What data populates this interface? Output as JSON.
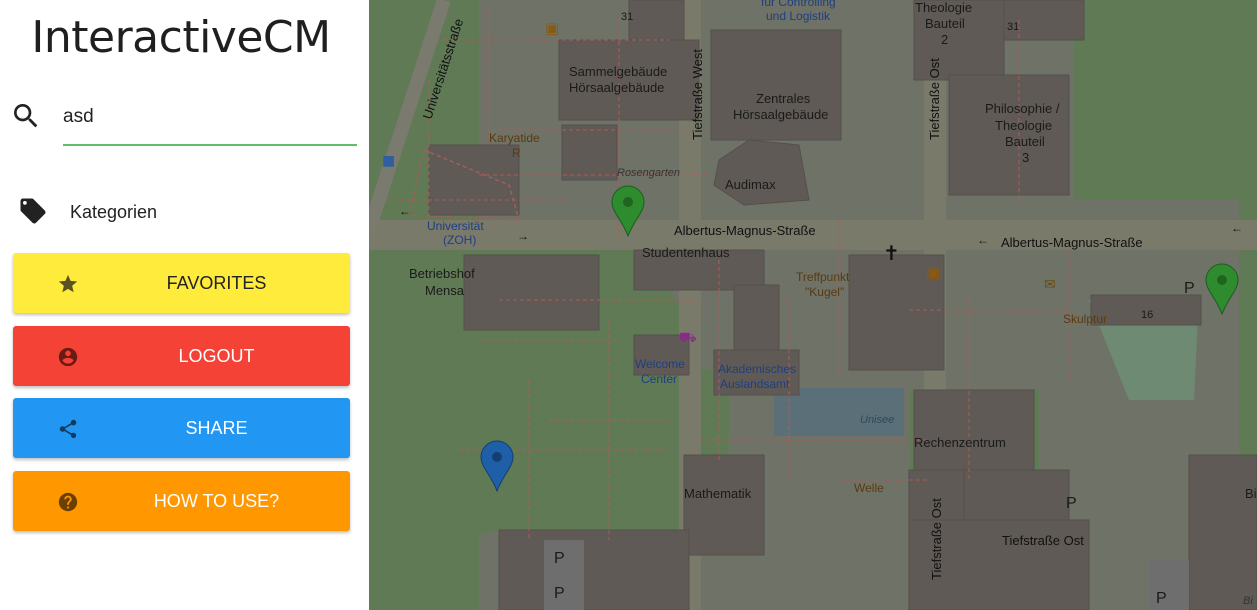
{
  "app": {
    "title": "InteractiveCM"
  },
  "search": {
    "value": "asd",
    "icon": "search-icon"
  },
  "categories": {
    "label": "Kategorien",
    "icon": "tag-icon"
  },
  "buttons": [
    {
      "id": "favorites",
      "label": "FAVORITES",
      "icon": "star-icon",
      "color": "#ffeb3b"
    },
    {
      "id": "logout",
      "label": "LOGOUT",
      "icon": "account-circle-icon",
      "color": "#f44336"
    },
    {
      "id": "share",
      "label": "SHARE",
      "icon": "share-icon",
      "color": "#2196f3"
    },
    {
      "id": "howto",
      "label": "HOW TO USE?",
      "icon": "help-icon",
      "color": "#ff9800"
    }
  ],
  "map": {
    "markers": [
      {
        "name": "green-marker-1",
        "color": "#2e8b2e"
      },
      {
        "name": "green-marker-2",
        "color": "#2e8b2e"
      },
      {
        "name": "blue-marker",
        "color": "#1e5fa8"
      }
    ],
    "labels": {
      "sammelgebaeude_1": "Sammelgebäude",
      "sammelgebaeude_2": "Hörsaalgebäude",
      "zentrales_1": "Zentrales",
      "zentrales_2": "Hörsaalgebäude",
      "audimax": "Audimax",
      "philosophie_1": "Philosophie /",
      "philosophie_2": "Theologie",
      "philosophie_3": "Bauteil",
      "philosophie_4": "3",
      "theologie_top_1": "Theologie",
      "theologie_top_2": "Bauteil",
      "theologie_top_3": "2",
      "controlling_1": "für Controlling",
      "controlling_2": "und Logistik",
      "num_31a": "31",
      "num_31b": "31",
      "karyatide_1": "Karyatide",
      "karyatide_2": "R",
      "rosengarten": "Rosengarten",
      "tiefstrasse_west": "Tiefstraße West",
      "tiefstrasse_ost_top": "Tiefstraße Ost",
      "tiefstrasse_ost_bottom": "Tiefstraße Ost",
      "tiefstrasse_ost_h": "Tiefstraße Ost",
      "universitaetsstrasse": "Universitätsstraße",
      "albertus_1": "Albertus-Magnus-Straße",
      "albertus_2": "Albertus-Magnus-Straße",
      "universitaet_zoh_1": "Universität",
      "universitaet_zoh_2": "(ZOH)",
      "studentenhaus": "Studentenhaus",
      "treffpunkt_1": "Treffpunkt",
      "treffpunkt_2": "\"Kugel\"",
      "betriebshof_1": "Betriebshof",
      "betriebshof_2": "Mensa",
      "welcome_1": "Welcome",
      "welcome_2": "Center",
      "akademisches_1": "Akademisches",
      "akademisches_2": "Auslandsamt",
      "unisee": "Unisee",
      "rechenzentrum": "Rechenzentrum",
      "mathematik": "Mathematik",
      "welle": "Welle",
      "skulptur": "Skulptur",
      "num_16": "16",
      "parking_p": "P",
      "bi_1": "Bi",
      "bi_2": "Bi"
    }
  }
}
